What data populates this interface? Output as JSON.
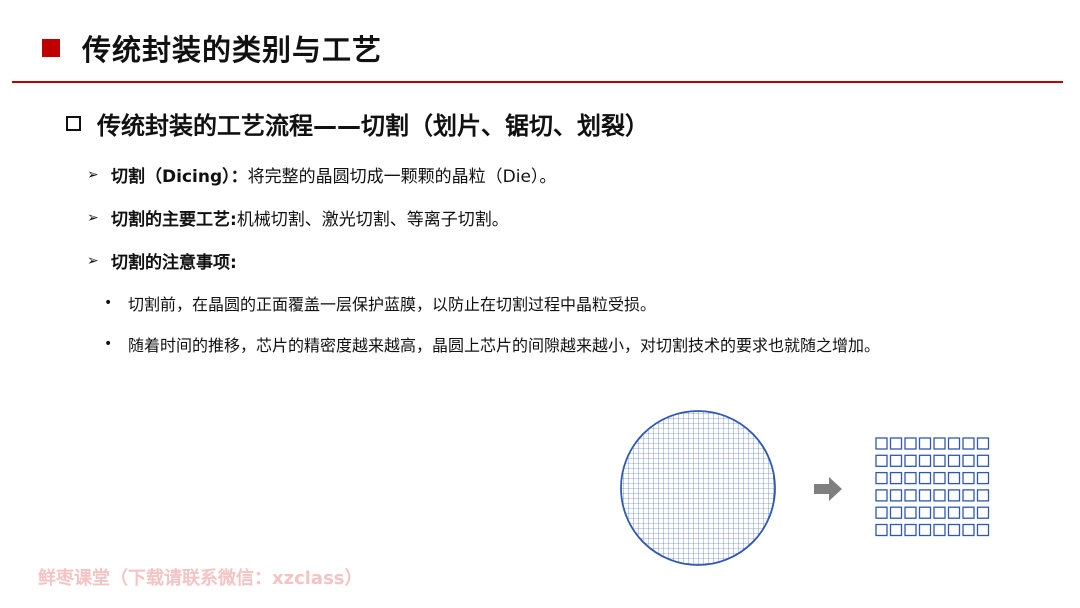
{
  "header": {
    "title": "传统封装的类别与工艺"
  },
  "section": {
    "subtitle": "传统封装的工艺流程——切割（划片、锯切、划裂）"
  },
  "bullets": [
    {
      "label": "切割（Dicing）：",
      "text": "将完整的晶圆切成一颗颗的晶粒（Die）。"
    },
    {
      "label": "切割的主要工艺:",
      "text": " 机械切割、激光切割、等离子切割。"
    },
    {
      "label": "切割的注意事项:",
      "text": ""
    }
  ],
  "notes": [
    "切割前，在晶圆的正面覆盖一层保护蓝膜，以防止在切割过程中晶粒受损。",
    "随着时间的推移，芯片的精密度越来越高，晶圆上芯片的间隙越来越小，对切割技术的要求也就随之增加。"
  ],
  "watermark": "鲜枣课堂（下载请联系微信：xzclass）",
  "colors": {
    "accent": "#c00000",
    "wafer_grid": "#2f57b5",
    "arrow": "#7f7f7f"
  },
  "figure": {
    "die_rows": 6,
    "die_cols": 8
  }
}
